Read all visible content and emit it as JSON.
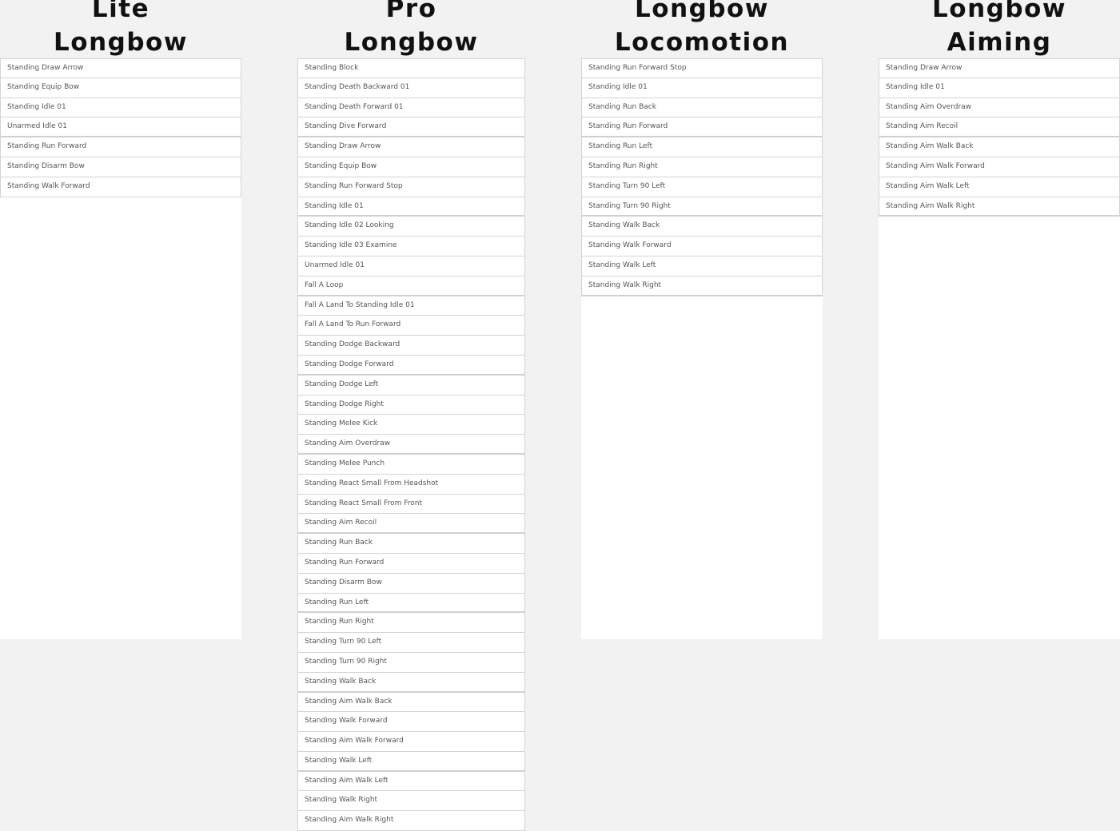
{
  "columns": [
    {
      "id": "lite-longbow",
      "title": [
        "Lite",
        "Longbow"
      ],
      "items": [
        "Standing Draw Arrow",
        "Standing Equip Bow",
        "Standing Idle 01",
        "Unarmed Idle 01",
        "Standing Run Forward",
        "Standing Disarm Bow",
        "Standing Walk Forward"
      ]
    },
    {
      "id": "pro-longbow",
      "title": [
        "Pro",
        "Longbow"
      ],
      "items": [
        "Standing Block",
        "Standing Death Backward 01",
        "Standing Death Forward 01",
        "Standing Dive Forward",
        "Standing Draw Arrow",
        "Standing Equip Bow",
        "Standing Run Forward Stop",
        "Standing Idle 01",
        "Standing Idle 02 Looking",
        "Standing Idle 03 Examine",
        "Unarmed Idle 01",
        "Fall A Loop",
        "Fall A Land To Standing Idle 01",
        "Fall A Land To Run Forward",
        "Standing Dodge Backward",
        "Standing Dodge Forward",
        "Standing Dodge Left",
        "Standing Dodge Right",
        "Standing Melee Kick",
        "Standing Aim Overdraw",
        "Standing Melee Punch",
        "Standing React Small From Headshot",
        "Standing React Small From Front",
        "Standing Aim Recoil",
        "Standing Run Back",
        "Standing Run Forward",
        "Standing Disarm Bow",
        "Standing Run Left",
        "Standing Run Right",
        "Standing Turn 90 Left",
        "Standing Turn 90 Right",
        "Standing Walk Back",
        "Standing Aim Walk Back",
        "Standing Walk Forward",
        "Standing Aim Walk Forward",
        "Standing Walk Left",
        "Standing Aim Walk Left",
        "Standing Walk Right",
        "Standing Aim Walk Right"
      ]
    },
    {
      "id": "longbow-locomotion",
      "title": [
        "Longbow",
        "Locomotion"
      ],
      "items": [
        "Standing Run Forward Stop",
        "Standing Idle 01",
        "Standing Run Back",
        "Standing Run Forward",
        "Standing Run Left",
        "Standing Run Right",
        "Standing Turn 90 Left",
        "Standing Turn 90 Right",
        "Standing Walk Back",
        "Standing Walk Forward",
        "Standing Walk Left",
        "Standing Walk Right"
      ]
    },
    {
      "id": "longbow-aiming",
      "title": [
        "Longbow",
        "Aiming"
      ],
      "items": [
        "Standing Draw Arrow",
        "Standing Idle 01",
        "Standing Aim Overdraw",
        "Standing Aim Recoil",
        "Standing Aim Walk Back",
        "Standing Aim Walk Forward",
        "Standing Aim Walk Left",
        "Standing Aim Walk Right"
      ]
    }
  ]
}
